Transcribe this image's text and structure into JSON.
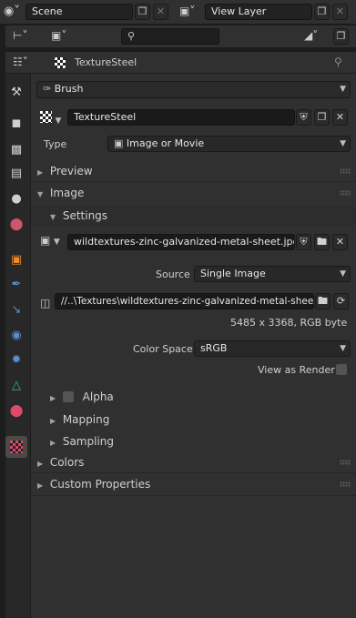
{
  "top_bar": {
    "scene_label": "Scene",
    "view_layer_label": "View Layer"
  },
  "outliner_search": {
    "placeholder": ""
  },
  "editor_header": {
    "datablock_name": "TextureSteel"
  },
  "brush_selector": {
    "value": "Brush"
  },
  "texture_datablock": {
    "name": "TextureSteel"
  },
  "type_row": {
    "label": "Type",
    "value": "Image or Movie"
  },
  "panels": {
    "preview": "Preview",
    "image": "Image",
    "settings": "Settings",
    "alpha": "Alpha",
    "mapping": "Mapping",
    "sampling": "Sampling",
    "colors": "Colors",
    "custom_properties": "Custom Properties"
  },
  "image_datablock": {
    "name": "wildtextures-zinc-galvanized-metal-sheet.jpg"
  },
  "source_row": {
    "label": "Source",
    "value": "Single Image"
  },
  "filepath": {
    "value": "//..\\Textures\\wildtextures-zinc-galvanized-metal-sheet..."
  },
  "image_info": "5485 x 3368,  RGB byte",
  "color_space": {
    "label": "Color Space",
    "value": "sRGB"
  },
  "view_as_render": {
    "label": "View as Render",
    "checked": false
  },
  "alpha": {
    "checked": false
  },
  "colors_theme": {
    "accent_active_tab": "#5680c2",
    "panel_bg": "#303030",
    "sidebar_bg": "#282828"
  },
  "sidebar_tabs": [
    "tool-tab",
    "render-tab",
    "output-tab",
    "view-layer-tab",
    "scene-tab",
    "world-tab",
    "object-tab",
    "modifier-tab",
    "particles-tab",
    "physics-tab",
    "constraints-tab",
    "data-tab",
    "material-tab",
    "texture-tab"
  ]
}
